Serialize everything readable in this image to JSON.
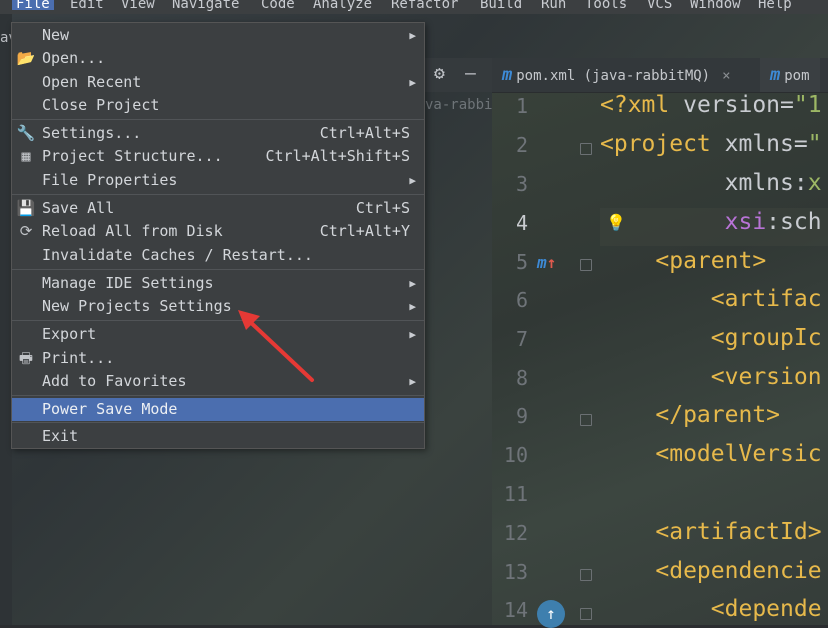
{
  "menubar": {
    "items": [
      "File",
      "Edit",
      "View",
      "Navigate",
      "Code",
      "Analyze",
      "Refactor",
      "Build",
      "Run",
      "Tools",
      "VCS",
      "Window",
      "Help"
    ]
  },
  "left_stub_text": "av",
  "project_panel": {
    "label": "va-rabbi",
    "gear_icon": "gear-icon",
    "minus_icon": "minus-icon"
  },
  "tabs": [
    {
      "label": "pom.xml (java-rabbitMQ)",
      "icon": "m",
      "close": "×"
    },
    {
      "label": "pom",
      "icon": "m"
    }
  ],
  "editor": {
    "line_numbers": [
      "1",
      "2",
      "3",
      "4",
      "5",
      "6",
      "7",
      "8",
      "9",
      "10",
      "11",
      "12",
      "13",
      "14"
    ],
    "current_line": "4",
    "lines": [
      {
        "parts": [
          [
            "tag",
            "<?xml "
          ],
          [
            "attr",
            "version="
          ],
          [
            "str",
            "\"1"
          ]
        ]
      },
      {
        "parts": [
          [
            "tag",
            "<project "
          ],
          [
            "attr",
            "xmlns="
          ],
          [
            "str",
            "\""
          ]
        ]
      },
      {
        "parts": [
          [
            "attr",
            "         xmlns:"
          ],
          [
            "str",
            "x"
          ]
        ]
      },
      {
        "parts": [
          [
            "ns",
            "         xsi"
          ],
          [
            "attr",
            ":sch"
          ]
        ]
      },
      {
        "parts": [
          [
            "tag",
            "    <parent>"
          ]
        ]
      },
      {
        "parts": [
          [
            "tag",
            "        <artifac"
          ]
        ]
      },
      {
        "parts": [
          [
            "tag",
            "        <groupIc"
          ]
        ]
      },
      {
        "parts": [
          [
            "tag",
            "        <version"
          ]
        ]
      },
      {
        "parts": [
          [
            "tag",
            "    </parent>"
          ]
        ]
      },
      {
        "parts": [
          [
            "tag",
            "    <modelVersic"
          ]
        ]
      },
      {
        "parts": [
          [
            "tag",
            ""
          ]
        ]
      },
      {
        "parts": [
          [
            "tag",
            "    <artifactId>"
          ]
        ]
      },
      {
        "parts": [
          [
            "tag",
            "    <dependencie"
          ]
        ]
      },
      {
        "parts": [
          [
            "tag",
            "        <depende"
          ]
        ]
      }
    ]
  },
  "file_menu": {
    "items": [
      {
        "label": "New",
        "shortcut": "",
        "submenu": true,
        "icon": ""
      },
      {
        "label": "Open...",
        "shortcut": "",
        "submenu": false,
        "icon": "folder-open-icon"
      },
      {
        "label": "Open Recent",
        "shortcut": "",
        "submenu": true,
        "icon": ""
      },
      {
        "label": "Close Project",
        "shortcut": "",
        "submenu": false,
        "icon": ""
      },
      {
        "label": "Settings...",
        "shortcut": "Ctrl+Alt+S",
        "submenu": false,
        "icon": "wrench-icon"
      },
      {
        "label": "Project Structure...",
        "shortcut": "Ctrl+Alt+Shift+S",
        "submenu": false,
        "icon": "project-structure-icon"
      },
      {
        "label": "File Properties",
        "shortcut": "",
        "submenu": true,
        "icon": ""
      },
      {
        "label": "Save All",
        "shortcut": "Ctrl+S",
        "submenu": false,
        "icon": "save-icon"
      },
      {
        "label": "Reload All from Disk",
        "shortcut": "Ctrl+Alt+Y",
        "submenu": false,
        "icon": "reload-icon"
      },
      {
        "label": "Invalidate Caches / Restart...",
        "shortcut": "",
        "submenu": false,
        "icon": ""
      },
      {
        "label": "Manage IDE Settings",
        "shortcut": "",
        "submenu": true,
        "icon": ""
      },
      {
        "label": "New Projects Settings",
        "shortcut": "",
        "submenu": true,
        "icon": ""
      },
      {
        "label": "Export",
        "shortcut": "",
        "submenu": true,
        "icon": ""
      },
      {
        "label": "Print...",
        "shortcut": "",
        "submenu": false,
        "icon": "print-icon"
      },
      {
        "label": "Add to Favorites",
        "shortcut": "",
        "submenu": true,
        "icon": ""
      },
      {
        "label": "Power Save Mode",
        "shortcut": "",
        "submenu": false,
        "icon": "",
        "selected": true
      },
      {
        "label": "Exit",
        "shortcut": "",
        "submenu": false,
        "icon": ""
      }
    ]
  },
  "colors": {
    "selection": "#4b6eaf",
    "annotation_arrow": "#e53935",
    "tag": "#e7b94b",
    "maven_blue": "#3d8ad6"
  }
}
